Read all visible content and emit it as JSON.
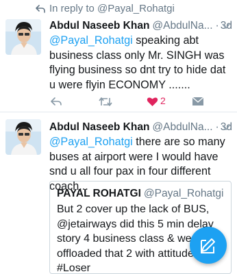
{
  "reply_banner": {
    "text": "In reply to @Payal_Rohatgi"
  },
  "tweets": [
    {
      "author_name": "Abdul Naseeb Khan",
      "handle": "@AbdulNa...",
      "dot": "·",
      "time": "3d",
      "mention": "@Payal_Rohatgi",
      "text": " speaking abt business class only Mr. SINGH was flying business so dnt try to hide dat u were flyin ECONOMY .......",
      "like_count": "2"
    },
    {
      "author_name": "Abdul Naseeb Khan",
      "handle": "@AbdulNa...",
      "dot": "·",
      "time": "3d",
      "mention": "@Payal_Rohatgi",
      "text": " there are so many buses at airport were I would have snd u all four pax in four different coach...",
      "quote": {
        "author_name": "PAYAL ROHATGI",
        "handle": "@Payal_Rohatgi",
        "text": "But 2 cover up the lack of BUS, @jetairways did this 5 min delay story 4 business class & we were offloaded that 2 with attitude #Loser"
      }
    }
  ],
  "colors": {
    "accent": "#1da1f2",
    "like": "#e0245e",
    "secondary_text": "#657786",
    "border": "#e1e8ed"
  },
  "icons": [
    "reply-arrow-icon",
    "chevron-down-icon",
    "reply-icon",
    "retweet-icon",
    "heart-icon",
    "direct-message-icon",
    "compose-icon"
  ]
}
